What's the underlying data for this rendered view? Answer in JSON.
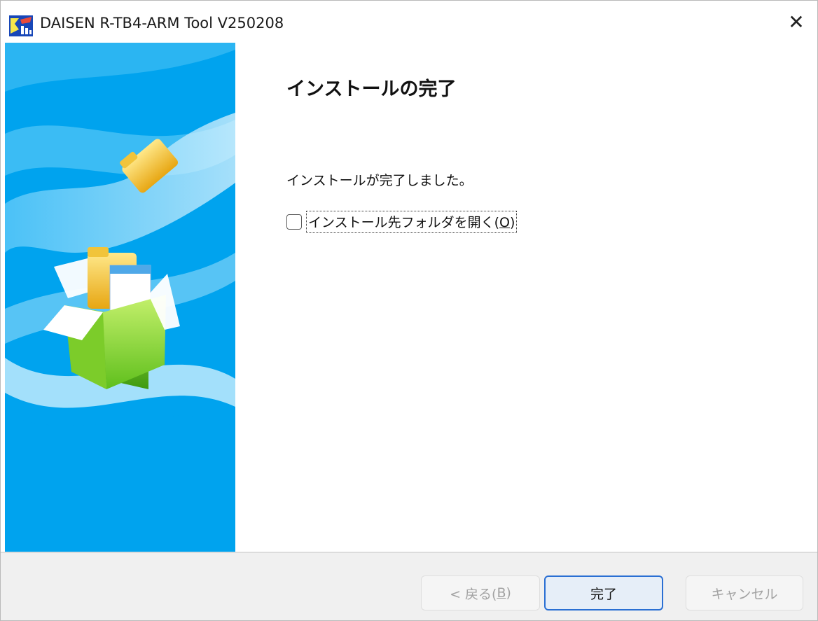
{
  "window": {
    "title": "DAISEN R-TB4-ARM Tool V250208",
    "close_glyph": "✕"
  },
  "content": {
    "heading": "インストールの完了",
    "message": "インストールが完了しました。",
    "open_folder_checkbox": {
      "label_prefix": "インストール先フォルダを開く(",
      "accelerator": "O",
      "label_suffix": ")",
      "checked": false
    }
  },
  "footer": {
    "back_button": {
      "label_prefix": "< 戻る(",
      "accelerator": "B",
      "label_suffix": ")",
      "enabled": false
    },
    "finish_button": {
      "label": "完了",
      "enabled": true,
      "default": true
    },
    "cancel_button": {
      "label": "キャンセル",
      "enabled": false
    }
  },
  "colors": {
    "art_background": "#00a3ee",
    "default_button_border": "#2a6fd3",
    "footer_background": "#f0f0f0"
  },
  "icons": {
    "app": "daisen-app-icon",
    "art": "install-box-with-folder-illustration"
  }
}
